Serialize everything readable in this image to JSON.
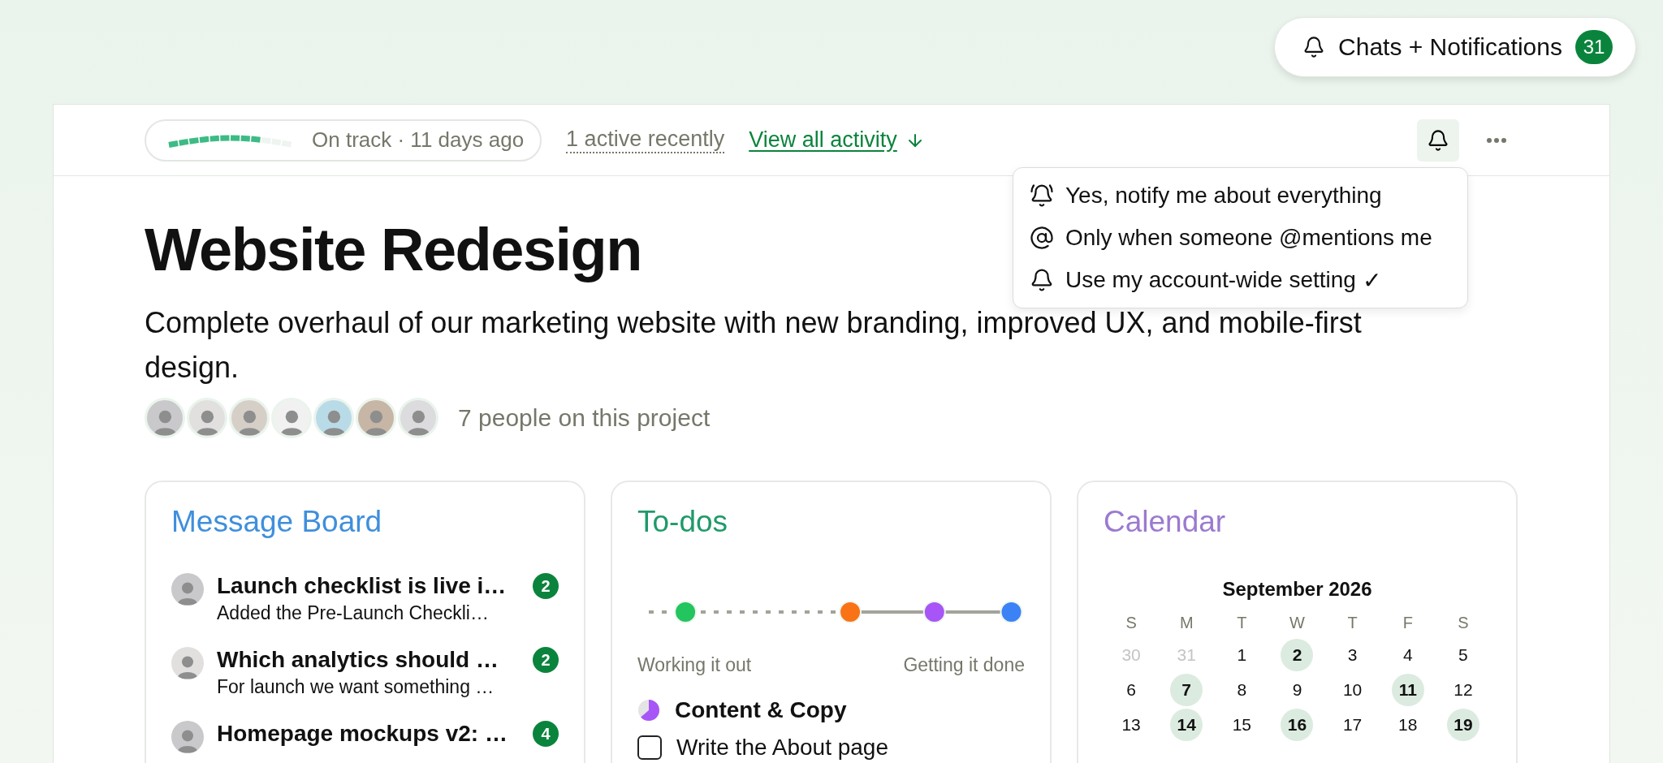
{
  "notifications_button": {
    "label": "Chats + Notifications",
    "count": "31"
  },
  "activity_bar": {
    "progress": {
      "level": 0.7,
      "status": "On track · 11 days ago"
    },
    "active": "1 active recently",
    "view_all": "View all activity"
  },
  "notify_menu": {
    "check_mark": "✓",
    "items": [
      {
        "kind": "everything",
        "label": "Yes, notify me about everything",
        "selected": false
      },
      {
        "kind": "mentions",
        "label": "Only when someone @mentions me",
        "selected": false
      },
      {
        "kind": "default",
        "label": "Use my account-wide setting",
        "selected": true
      }
    ]
  },
  "project": {
    "title": "Website Redesign",
    "description": "Complete overhaul of our marketing website with new branding, improved UX, and mobile-first design.",
    "avatars": [
      {
        "color": "#c9c9cc"
      },
      {
        "color": "#e2e0de"
      },
      {
        "color": "#d6cfc8"
      },
      {
        "color": "#f1f1f1"
      },
      {
        "color": "#b9dbe8"
      },
      {
        "color": "#c7b6a5"
      },
      {
        "color": "#dcdcde"
      }
    ],
    "people": "7 people on this project"
  },
  "message_board": {
    "title": "Message Board",
    "messages": [
      {
        "title": "Launch checklist is live i…",
        "excerpt": "Added the Pre-Launch Checkli…",
        "count": "2",
        "color": "#c9c9cc"
      },
      {
        "title": "Which analytics should …",
        "excerpt": "For launch we want something …",
        "count": "2",
        "color": "#e2e0de"
      },
      {
        "title": "Homepage mockups v2: …",
        "count": "4",
        "color": "#c9c9cc"
      }
    ]
  },
  "todos": {
    "title": "To-dos",
    "hill": {
      "dots": [
        {
          "color": "#22c55e",
          "level": 0.1
        },
        {
          "color": "#f97316",
          "level": 0.55
        },
        {
          "color": "#a855f7",
          "level": 0.78
        },
        {
          "color": "#3b82f6",
          "level": 0.99
        }
      ],
      "left_label": "Working it out",
      "right_label": "Getting it done"
    },
    "group": {
      "title": "Content & Copy",
      "level": 0.62,
      "color": "#a855f7"
    },
    "items": [
      {
        "label": "Write the About page",
        "checked": false
      }
    ]
  },
  "calendar": {
    "title": "Calendar",
    "month": "September 2026",
    "weekdays": [
      "S",
      "M",
      "T",
      "W",
      "T",
      "F",
      "S"
    ],
    "weeks": [
      [
        {
          "day": "30",
          "outside": true,
          "events": false
        },
        {
          "day": "31",
          "outside": true,
          "events": false
        },
        {
          "day": "1",
          "outside": false,
          "events": false
        },
        {
          "day": "2",
          "outside": false,
          "events": true
        },
        {
          "day": "3",
          "outside": false,
          "events": false
        },
        {
          "day": "4",
          "outside": false,
          "events": false
        },
        {
          "day": "5",
          "outside": false,
          "events": false
        }
      ],
      [
        {
          "day": "6",
          "outside": false,
          "events": false
        },
        {
          "day": "7",
          "outside": false,
          "events": true
        },
        {
          "day": "8",
          "outside": false,
          "events": false
        },
        {
          "day": "9",
          "outside": false,
          "events": false
        },
        {
          "day": "10",
          "outside": false,
          "events": false
        },
        {
          "day": "11",
          "outside": false,
          "events": true
        },
        {
          "day": "12",
          "outside": false,
          "events": false
        }
      ],
      [
        {
          "day": "13",
          "outside": false,
          "events": false
        },
        {
          "day": "14",
          "outside": false,
          "events": true
        },
        {
          "day": "15",
          "outside": false,
          "events": false
        },
        {
          "day": "16",
          "outside": false,
          "events": true
        },
        {
          "day": "17",
          "outside": false,
          "events": false
        },
        {
          "day": "18",
          "outside": false,
          "events": false
        },
        {
          "day": "19",
          "outside": false,
          "events": true
        }
      ]
    ]
  }
}
